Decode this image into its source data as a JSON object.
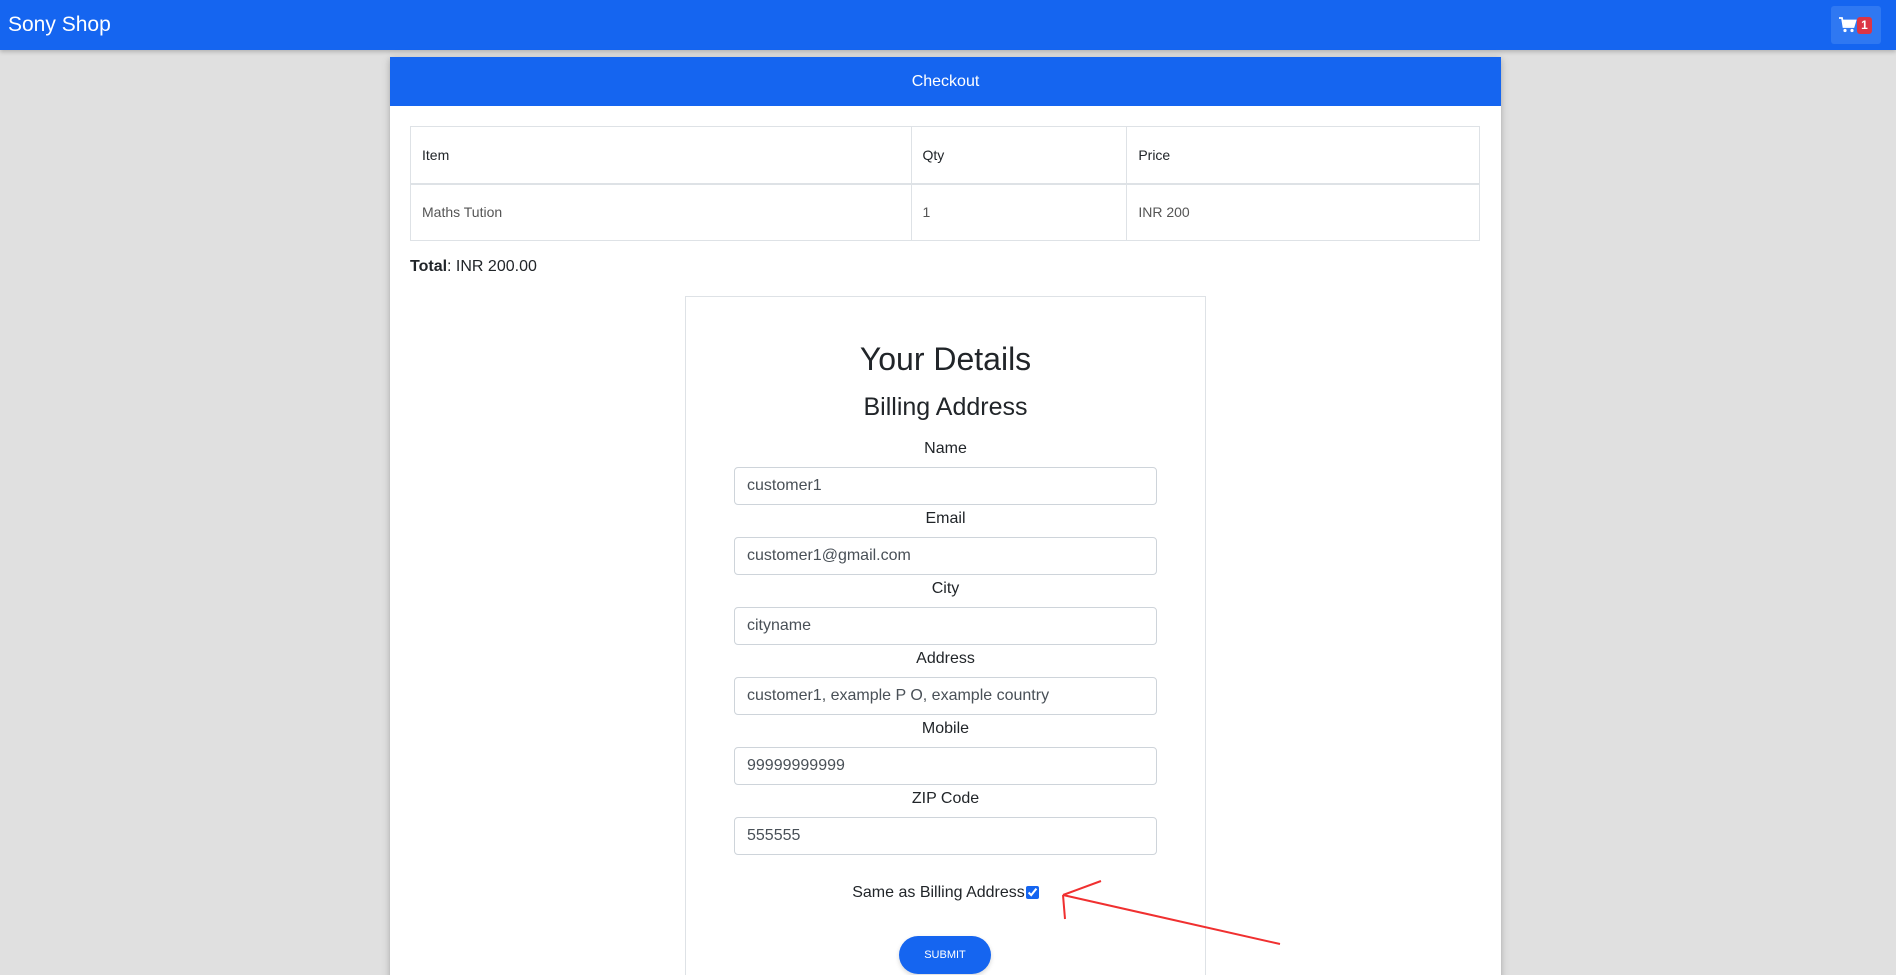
{
  "navbar": {
    "brand": "Sony Shop",
    "cart_count": "1",
    "cart_icon": "shopping-cart-icon"
  },
  "checkout": {
    "header": "Checkout",
    "table": {
      "columns": [
        "Item",
        "Qty",
        "Price"
      ],
      "rows": [
        {
          "item": "Maths Tution",
          "qty": "1",
          "price": "INR 200"
        }
      ]
    },
    "total_label": "Total",
    "total_value": ": INR 200.00"
  },
  "details": {
    "title": "Your Details",
    "billing_title": "Billing Address",
    "fields": [
      {
        "label": "Name",
        "value": "customer1"
      },
      {
        "label": "Email",
        "value": "customer1@gmail.com"
      },
      {
        "label": "City",
        "value": "cityname"
      },
      {
        "label": "Address",
        "value": "customer1, example P O, example country"
      },
      {
        "label": "Mobile",
        "value": "99999999999"
      },
      {
        "label": "ZIP Code",
        "value": "555555"
      }
    ],
    "same_as_billing_label": "Same as Billing Address",
    "same_as_billing_checked": true,
    "submit_label": "SUBMIT"
  },
  "colors": {
    "primary": "#1565f0",
    "badge": "#dc3545",
    "annotation": "#f03030",
    "page_bg": "#e0e0e0"
  }
}
